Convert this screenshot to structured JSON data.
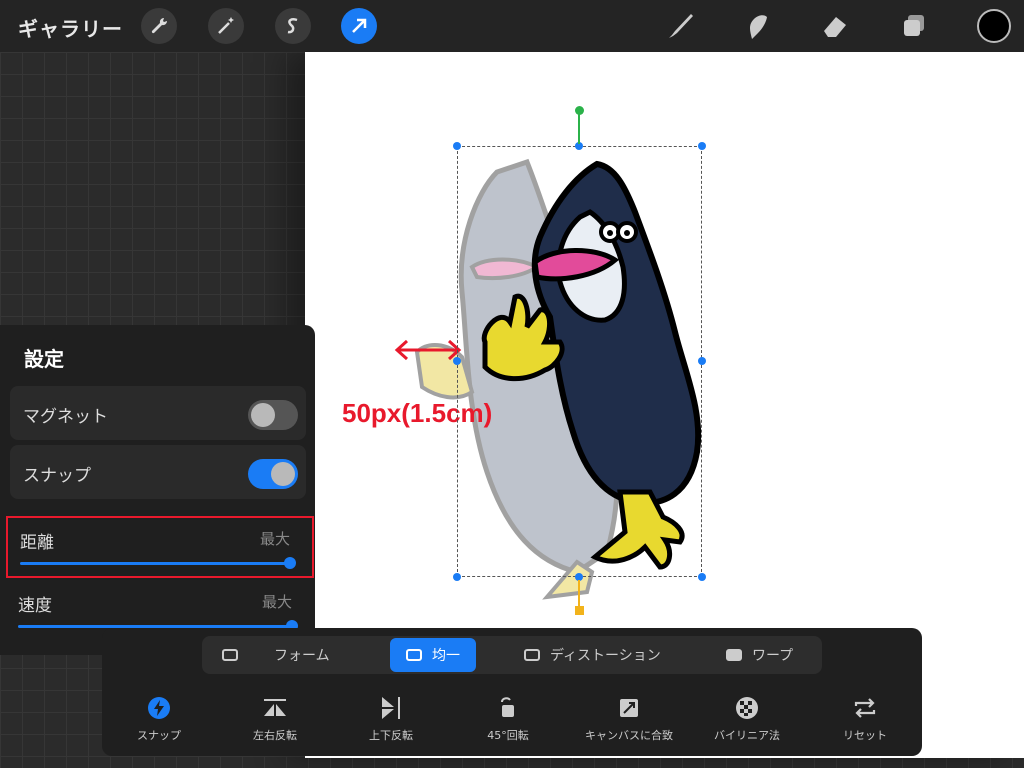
{
  "topbar": {
    "gallery_label": "ギャラリー",
    "tools": [
      "wrench-icon",
      "magic-wand-icon",
      "selection-s-icon",
      "transform-arrow-icon"
    ],
    "right_tools": [
      "brush-icon",
      "smudge-icon",
      "eraser-icon",
      "layers-icon"
    ],
    "current_color": "#000000"
  },
  "canvas": {
    "measurement_label": "50px(1.5cm)"
  },
  "settings": {
    "title": "設定",
    "magnet": {
      "label": "マグネット",
      "enabled": false
    },
    "snap": {
      "label": "スナップ",
      "enabled": true
    },
    "distance": {
      "label": "距離",
      "value": "最大",
      "level": 1.0
    },
    "speed": {
      "label": "速度",
      "value": "最大",
      "level": 1.0
    }
  },
  "transform_modes": {
    "freeform": "フォーム",
    "uniform": "均一",
    "distort": "ディストーション",
    "warp": "ワープ"
  },
  "tools": {
    "snap": "スナップ",
    "flip_h": "左右反転",
    "flip_v": "上下反転",
    "rotate": "45°回転",
    "fit": "キャンバスに合致",
    "bilinear": "バイリニア法",
    "reset": "リセット"
  },
  "colors": {
    "accent": "#1a7cf5",
    "highlight": "#e8192c"
  }
}
